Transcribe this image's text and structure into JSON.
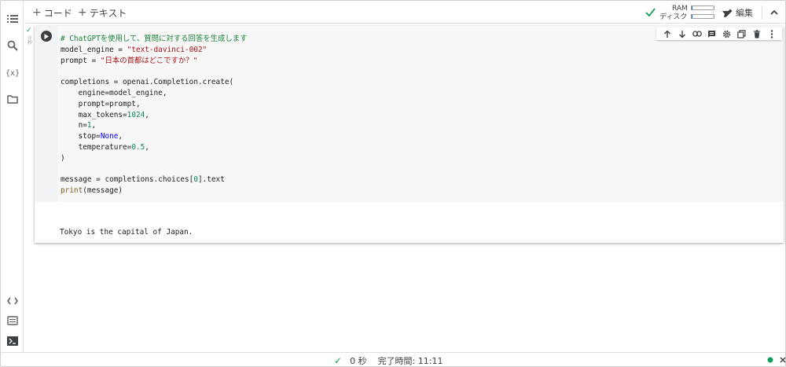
{
  "toolbar": {
    "add_code_label": "コード",
    "add_text_label": "テキスト",
    "ram_label": "RAM",
    "disk_label": "ディスク",
    "edit_label": "編集",
    "ram_usage": 0.05,
    "disk_usage": 0.05
  },
  "cell": {
    "exec_check": "✓",
    "exec_time": "0 秒",
    "code_lines": [
      "# ChatGPTを使用して、質問に対する回答を生成します",
      "model_engine = \"text-davinci-002\"",
      "prompt = \"日本の首都はどこですか？\"",
      "",
      "completions = openai.Completion.create(",
      "    engine=model_engine,",
      "    prompt=prompt,",
      "    max_tokens=1024,",
      "    n=1,",
      "    stop=None,",
      "    temperature=0.5,",
      ")",
      "",
      "message = completions.choices[0].text",
      "print(message)"
    ],
    "output_text": "Tokyo is the capital of Japan."
  },
  "status": {
    "check": "✓",
    "elapsed": "0 秒",
    "completed": "完了時間: 11:11"
  },
  "colors": {
    "accent": "#1a73e8",
    "success": "#0f9d58",
    "comment": "#188038",
    "string": "#a31515",
    "number": "#098658",
    "keyword": "#0000ff"
  }
}
